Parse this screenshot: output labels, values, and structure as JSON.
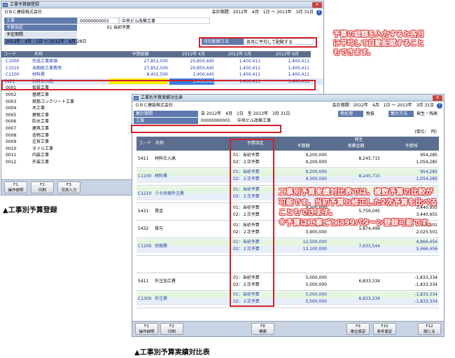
{
  "top": {
    "title": "工事予算額登録",
    "company": "ＯＢＣ建設株式会社",
    "period": "会計期間：2012年　4月　1日 ～ 2013年　3月 31日",
    "help": "?",
    "f_koji_label": "工事",
    "f_koji_code": "00000000001",
    "f_koji_name": "中央ビル改築工事",
    "f_yosan_label": "予算指定",
    "f_yosan_val": "01 当初予算",
    "f_kikan_label": "予定期間",
    "f_kikan_val": "2012年　4月　1日 ～ 2012年　8月 28日",
    "f_haifu_label": "月別配賦方法",
    "f_haifu_val": "各月に平均して配賦する",
    "cols": [
      "コード",
      "名称",
      "予算総額",
      "2012年 4月",
      "2012年 5月",
      "2012年 6月"
    ],
    "rows": [
      {
        "code": "C1000",
        "name": "完成工事原価",
        "total": "27,852,500",
        "m4": "20,850,445",
        "m5": "1,400,411",
        "m6": "1,400,411"
      },
      {
        "code": "C1010",
        "name": "当期総工事費用",
        "total": "27,852,500",
        "m4": "20,850,445",
        "m5": "1,400,411",
        "m6": "1,400,411"
      },
      {
        "code": "C1100",
        "name": "材料費",
        "total": "8,402,500",
        "m4": "1,400,445",
        "m5": "1,400,411",
        "m6": "1,400,411"
      },
      {
        "code": "5411",
        "name": "材料仕入高",
        "total": "",
        "m4": "1,400,445",
        "m5": "1,400,411",
        "m6": "1,400,411"
      },
      {
        "code": "0001",
        "name": "仮設工事",
        "total": "",
        "m4": "",
        "m5": "",
        "m6": ""
      },
      {
        "code": "0002",
        "name": "基礎工事",
        "total": "",
        "m4": "",
        "m5": "",
        "m6": ""
      },
      {
        "code": "0003",
        "name": "鉄筋コンクリート工事",
        "total": "",
        "m4": "",
        "m5": "",
        "m6": ""
      },
      {
        "code": "0004",
        "name": "木工事",
        "total": "",
        "m4": "",
        "m5": "",
        "m6": ""
      },
      {
        "code": "0005",
        "name": "屋根工事",
        "total": "",
        "m4": "",
        "m5": "",
        "m6": ""
      },
      {
        "code": "0006",
        "name": "防水工事",
        "total": "",
        "m4": "",
        "m5": "",
        "m6": ""
      },
      {
        "code": "0007",
        "name": "建具工事",
        "total": "",
        "m4": "",
        "m5": "",
        "m6": ""
      },
      {
        "code": "0008",
        "name": "金物工事",
        "total": "",
        "m4": "",
        "m5": "",
        "m6": ""
      },
      {
        "code": "0009",
        "name": "左官工事",
        "total": "",
        "m4": "",
        "m5": "",
        "m6": ""
      },
      {
        "code": "0010",
        "name": "タイル工事",
        "total": "",
        "m4": "",
        "m5": "",
        "m6": ""
      },
      {
        "code": "0011",
        "name": "内装工事",
        "total": "",
        "m4": "",
        "m5": "",
        "m6": ""
      },
      {
        "code": "0012",
        "name": "外装工事",
        "total": "",
        "m4": "",
        "m5": "",
        "m6": ""
      }
    ],
    "fkeys": [
      {
        "k": "F1",
        "l": "操作説明"
      },
      {
        "k": "F2",
        "l": "印刷"
      },
      {
        "k": "F3",
        "l": "月別入力"
      }
    ],
    "caption": "▲工事別予算登録"
  },
  "note1": "予算の総額を入力すると各月\nに平均して自動配賦すること\nもできます。",
  "bot": {
    "title": "工事別予算実績対比表",
    "company": "ＯＢＣ建設株式会社",
    "period": "会計期間：2012年　4月　1日 ～ 2013年　3月 31日",
    "help": "?",
    "kikan_label": "集計期間",
    "kikan_val": "自 2012年　4月　1日　至 2013年　3月 31日",
    "zei_label": "税処理",
    "zei_val": "税抜",
    "shukei_label": "集計方法",
    "shukei_val": "発生・残高",
    "koji_label": "工事",
    "koji_code": "00000000001",
    "koji_name": "中央ビル改築工事",
    "unit": "(単位：　円)",
    "col_code": "コード",
    "col_name": "名称",
    "col_yosan": "予算指定",
    "col_hassei": "発生",
    "col_yosangaku": "予算額",
    "col_jisseki": "実績金額",
    "col_zan": "予算残",
    "groups": [
      {
        "code": "5411",
        "name": "材料仕入高",
        "blue": false,
        "r1": "01：当初予算",
        "r2": "02：２次予算",
        "a1": "9,200,000",
        "a2": "9,200,000",
        "j": "8,245,715",
        "z1": "954,285",
        "z2": "1,054,285"
      },
      {
        "code": "C1100",
        "name": "材料費",
        "blue": true,
        "r1": "01：当初予算",
        "r2": "02：２次予算",
        "a1": "9,200,000",
        "a2": "9,300,000",
        "j": "8,245,715",
        "z1": "954,285",
        "z2": "1,054,285"
      },
      {
        "code": "C1210",
        "name": "うち労務外注費",
        "blue": true,
        "r1": "01：当初予算",
        "r2": "02：２次予算",
        "a1": "",
        "a2": "",
        "j": "",
        "z1": "",
        "z2": ""
      },
      {
        "code": "5431",
        "name": "賃金",
        "blue": false,
        "r1": "01：当初予算",
        "r2": "02：２次予算",
        "a1": "9,200,000",
        "a2": "9,200,000",
        "j": "5,759,045",
        "z1": "3,440,955",
        "z2": "3,440,955"
      },
      {
        "code": "5432",
        "name": "賞与",
        "blue": false,
        "r1": "01：当初予算",
        "r2": "02：２次予算",
        "a1": "3,800,000",
        "a2": "3,900,000",
        "j": "1,874,499",
        "z1": "1,925,501",
        "z2": "2,025,501"
      },
      {
        "code": "C1200",
        "name": "労務費",
        "blue": true,
        "r1": "01：当初予算",
        "r2": "02：２次予算",
        "a1": "12,500,000",
        "a2": "13,100,000",
        "j": "7,633,544",
        "z1": "4,866,456",
        "z2": "5,466,456"
      },
      {
        "code": "",
        "name": "",
        "blue": false,
        "r1": "",
        "r2": "",
        "a1": "",
        "a2": "",
        "j": "",
        "z1": "",
        "z2": ""
      },
      {
        "code": "5411",
        "name": "外注加工費",
        "blue": false,
        "r1": "01：当初予算",
        "r2": "02：２次予算",
        "a1": "5,000,000",
        "a2": "5,000,000",
        "j": "6,833,334",
        "z1": "-1,833,334",
        "z2": "-1,833,334"
      },
      {
        "code": "C1300",
        "name": "外注費",
        "blue": true,
        "r1": "01：当初予算",
        "r2": "02：２次予算",
        "a1": "5,000,000",
        "a2": "5,000,000",
        "j": "6,833,334",
        "z1": "-1,833,334",
        "z2": "-1,833,334"
      }
    ],
    "fkeys": [
      {
        "k": "F1",
        "l": "操作説明"
      },
      {
        "k": "F2",
        "l": "印刷"
      },
      {
        "k": "F8",
        "l": "検索"
      },
      {
        "k": "F9",
        "l": "単位設定"
      },
      {
        "k": "F10",
        "l": "条件設定"
      },
      {
        "k": "F12",
        "l": "閉じる"
      }
    ],
    "caption": "▲工事別予算実績対比表"
  },
  "note2": "工事別予算実績対比表では、複数予算の比較が\n可能です。当初予算と修正した2次予算を比べる\nこともできます。\n※予算は工事ごとに99パターン登録可能です。"
}
